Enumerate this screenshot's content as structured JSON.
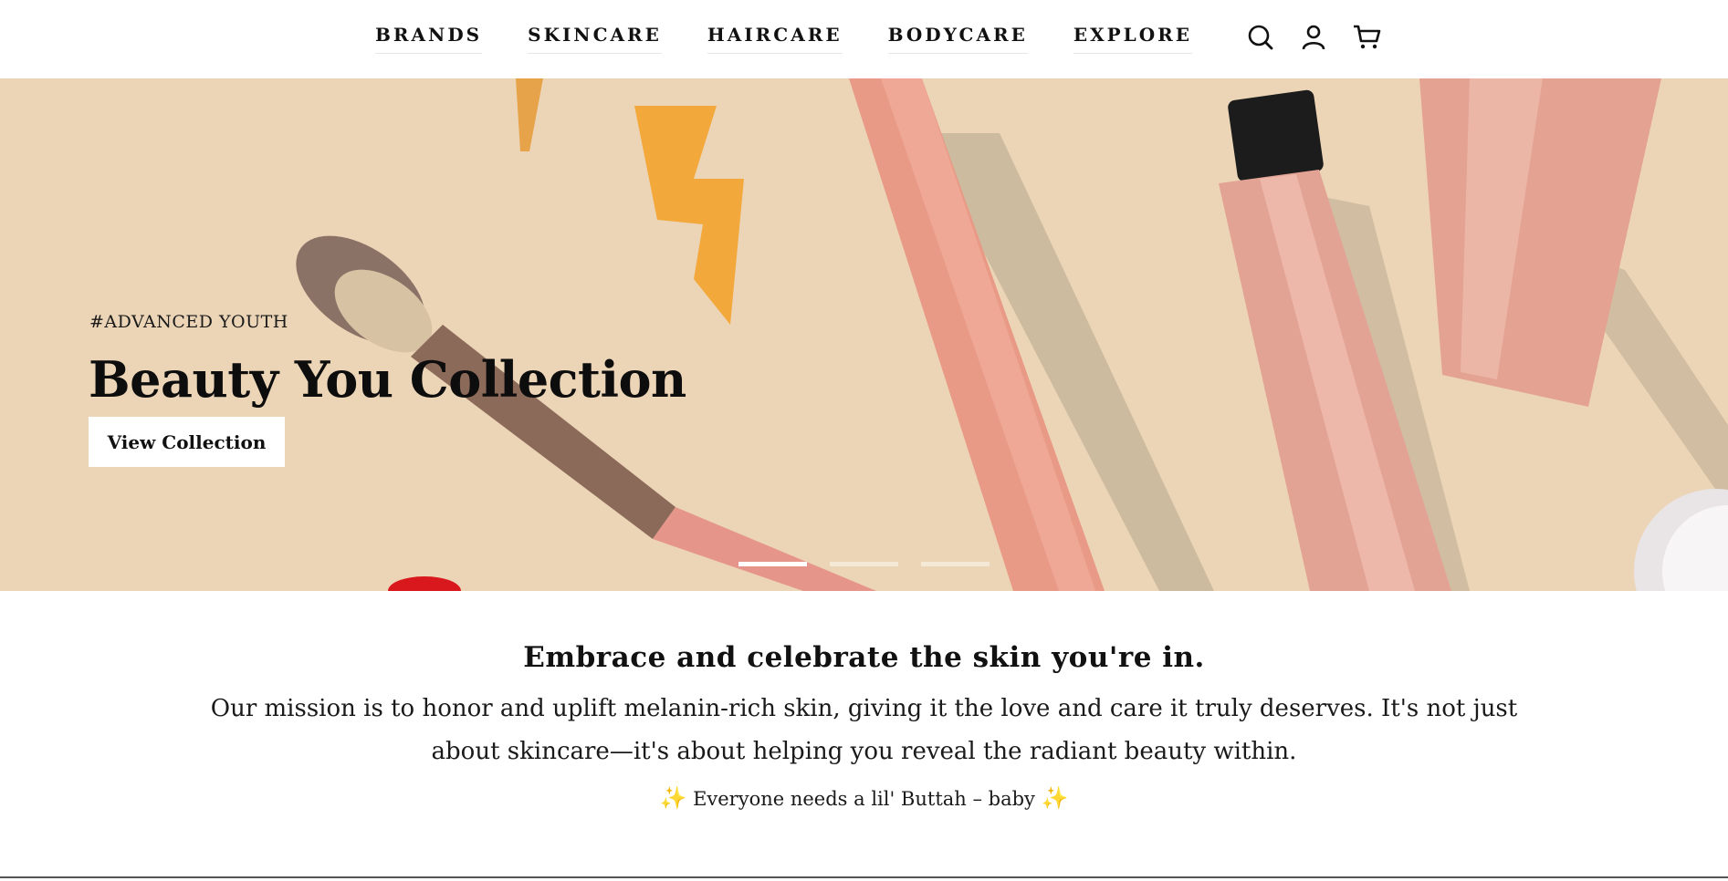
{
  "nav": {
    "items": [
      "BRANDS",
      "SKINCARE",
      "HAIRCARE",
      "BODYCARE",
      "EXPLORE"
    ],
    "icons": [
      "search-icon",
      "account-icon",
      "cart-icon"
    ]
  },
  "hero": {
    "tag": "#ADVANCED YOUTH",
    "title": "Beauty You Collection",
    "button_label": "View Collection",
    "slides_total": 3,
    "active_slide": 1,
    "background_color": "#ecd5b6"
  },
  "mission": {
    "heading": "Embrace and celebrate the skin you're in.",
    "text": "Our mission is to honor and uplift melanin-rich skin, giving it the love and care it truly deserves. It's not just about skincare—it's about helping you reveal the radiant beauty within.",
    "tagline_spark": "✨",
    "tagline": "Everyone needs a lil' Buttah – baby"
  }
}
